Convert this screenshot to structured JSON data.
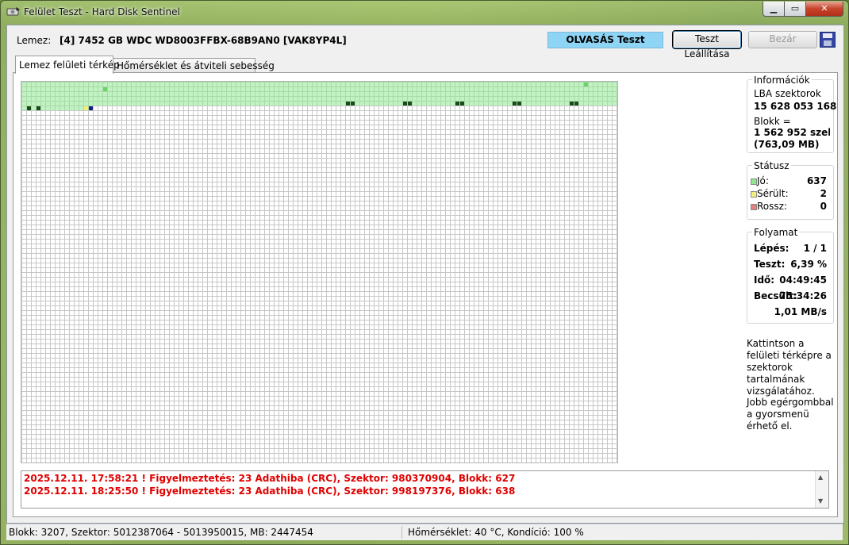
{
  "window": {
    "title": "Felület Teszt - Hard Disk Sentinel",
    "min_glyph": "▁",
    "max_glyph": "▭",
    "close_glyph": "✕"
  },
  "header": {
    "disk_label": "Lemez:",
    "disk_name": "[4] 7452 GB  WDC WD8003FFBX-68B9AN0 [VAK8YP4L]",
    "test_status": "OLVASÁS Teszt",
    "stop_button": "Teszt Leállítása",
    "close_button": "Bezár"
  },
  "tabs": [
    {
      "label": "Lemez felületi térkép",
      "active": true
    },
    {
      "label": "Hőmérséklet és átviteli sebesség",
      "active": false
    }
  ],
  "info": {
    "title": "Információk",
    "lba_label": "LBA szektorok",
    "lba_value": "15 628 053 168",
    "block_label": "Blokk =",
    "block_value": "1 562 952 szektor",
    "block_mb": "(763,09 MB)"
  },
  "status": {
    "title": "Státusz",
    "good_label": "Jó:",
    "good_value": "637",
    "damaged_label": "Sérült:",
    "damaged_value": "2",
    "bad_label": "Rossz:",
    "bad_value": "0",
    "colors": {
      "good": "#8ee88e",
      "damaged": "#f2f07a",
      "bad": "#e58080"
    }
  },
  "progress": {
    "title": "Folyamat",
    "step_label": "Lépés:",
    "step_value": "1 / 1",
    "test_label": "Teszt:",
    "test_value": "6,39 %",
    "time_label": "Idő:",
    "time_value": "04:49:45",
    "estimated_label": "Becsült:",
    "estimated_value": "75:34:26",
    "speed_value": "1,01 MB/s"
  },
  "hint": {
    "click": "Kattintson a felületi térképre a szektorok tartalmának vizsgálatához.",
    "right_click": "Jobb egérgombbal a gyorsmenü érhető el."
  },
  "log": [
    "2025.12.11.  17:58:21 ! Figyelmeztetés: 23 Adathiba (CRC), Szektor: 980370904, Blokk: 627",
    "2025.12.11.  18:25:50 ! Figyelmeztetés: 23 Adathiba (CRC), Szektor: 998197376, Blokk: 638"
  ],
  "statusbar": {
    "block_info": "Blokk: 3207, Szektor: 5012387064 - 5013950015, MB: 2447454",
    "temp_info": "Hőmérséklet: 40  °C,  Kondíció: 100 %"
  }
}
